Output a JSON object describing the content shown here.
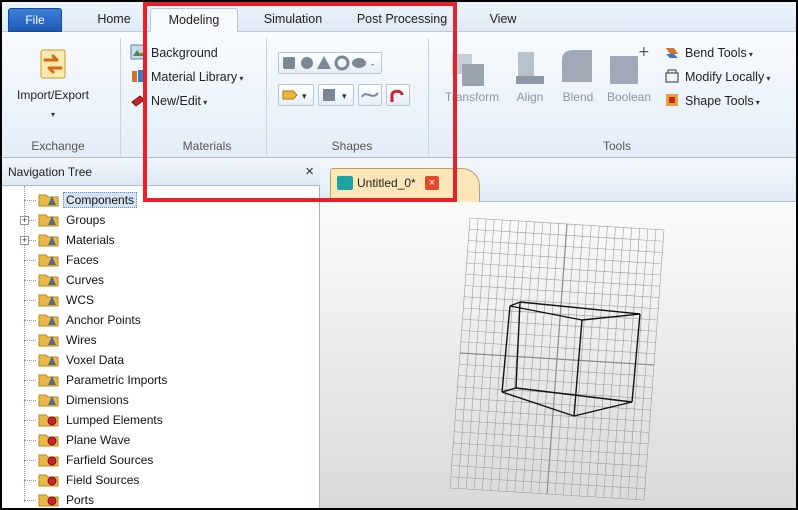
{
  "ribbon_tabs": {
    "file": "File",
    "home": "Home",
    "modeling": "Modeling",
    "simulation": "Simulation",
    "post_processing": "Post Processing",
    "view": "View"
  },
  "exchange": {
    "import_export": "Import/Export",
    "group": "Exchange"
  },
  "materials": {
    "background": "Background",
    "material_library": "Material Library",
    "new_edit": "New/Edit",
    "group": "Materials"
  },
  "shapes": {
    "group": "Shapes"
  },
  "tools": {
    "transform": "Transform",
    "align": "Align",
    "blend": "Blend",
    "boolean": "Boolean",
    "bend_tools": "Bend Tools",
    "modify_locally": "Modify Locally",
    "shape_tools": "Shape Tools",
    "group": "Tools"
  },
  "navigation": {
    "title": "Navigation Tree",
    "close": "×",
    "items": [
      {
        "label": "Components",
        "icon": "folder-cone-icon"
      },
      {
        "label": "Groups",
        "icon": "folder-cone-icon"
      },
      {
        "label": "Materials",
        "icon": "folder-cone-icon"
      },
      {
        "label": "Faces",
        "icon": "folder-cone-icon"
      },
      {
        "label": "Curves",
        "icon": "folder-cone-icon"
      },
      {
        "label": "WCS",
        "icon": "folder-cone-icon"
      },
      {
        "label": "Anchor Points",
        "icon": "folder-cone-icon"
      },
      {
        "label": "Wires",
        "icon": "folder-cone-icon"
      },
      {
        "label": "Voxel Data",
        "icon": "folder-cone-icon"
      },
      {
        "label": "Parametric Imports",
        "icon": "folder-cone-icon"
      },
      {
        "label": "Dimensions",
        "icon": "folder-cone-icon"
      },
      {
        "label": "Lumped Elements",
        "icon": "folder-gear-icon"
      },
      {
        "label": "Plane Wave",
        "icon": "folder-gear-icon"
      },
      {
        "label": "Farfield Sources",
        "icon": "folder-gear-icon"
      },
      {
        "label": "Field Sources",
        "icon": "folder-gear-icon"
      },
      {
        "label": "Ports",
        "icon": "folder-gear-icon"
      }
    ]
  },
  "document": {
    "tab_title": "Untitled_0*",
    "close": "×"
  },
  "colors": {
    "highlight": "#e8202a",
    "file_tab": "#1e5bb8",
    "doc_tab": "#fde6b8"
  }
}
